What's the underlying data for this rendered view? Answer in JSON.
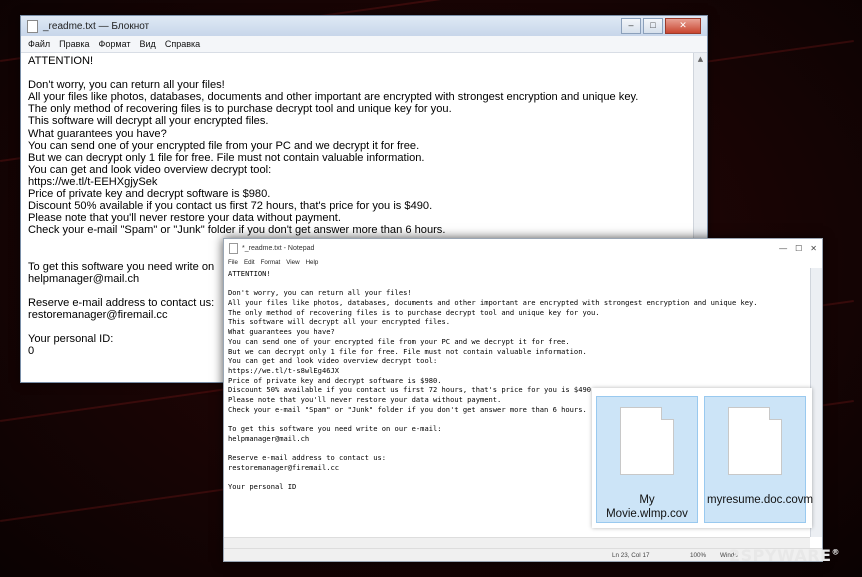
{
  "window1": {
    "title": "_readme.txt — Блокнот",
    "menu": [
      "Файл",
      "Правка",
      "Формат",
      "Вид",
      "Справка"
    ],
    "lines": [
      "ATTENTION!",
      "",
      "Don't worry, you can return all your files!",
      "All your files like photos, databases, documents and other important are encrypted with strongest encryption and unique key.",
      "The only method of recovering files is to purchase decrypt tool and unique key for you.",
      "This software will decrypt all your encrypted files.",
      "What guarantees you have?",
      "You can send one of your encrypted file from your PC and we decrypt it for free.",
      "But we can decrypt only 1 file for free. File must not contain valuable information.",
      "You can get and look video overview decrypt tool:",
      "https://we.tl/t-EEHXgjySek",
      "Price of private key and decrypt software is $980.",
      "Discount 50% available if you contact us first 72 hours, that's price for you is $490.",
      "Please note that you'll never restore your data without payment.",
      "Check your e-mail \"Spam\" or \"Junk\" folder if you don't get answer more than 6 hours.",
      "",
      "",
      "To get this software you need write on",
      "helpmanager@mail.ch",
      "",
      "Reserve e-mail address to contact us:",
      "restoremanager@firemail.cc",
      "",
      "Your personal ID:",
      "0"
    ]
  },
  "window2": {
    "title": "*_readme.txt - Notepad",
    "menu": [
      "File",
      "Edit",
      "Format",
      "View",
      "Help"
    ],
    "lines": [
      "ATTENTION!",
      "",
      "Don't worry, you can return all your files!",
      "All your files like photos, databases, documents and other important are encrypted with strongest encryption and unique key.",
      "The only method of recovering files is to purchase decrypt tool and unique key for you.",
      "This software will decrypt all your encrypted files.",
      "What guarantees you have?",
      "You can send one of your encrypted file from your PC and we decrypt it for free.",
      "But we can decrypt only 1 file for free. File must not contain valuable information.",
      "You can get and look video overview decrypt tool:",
      "https://we.tl/t-s8wlEg46JX",
      "Price of private key and decrypt software is $980.",
      "Discount 50% available if you contact us first 72 hours, that's price for you is $490.",
      "Please note that you'll never restore your data without payment.",
      "Check your e-mail \"Spam\" or \"Junk\" folder if you don't get answer more than 6 hours.",
      "",
      "To get this software you need write on our e-mail:",
      "helpmanager@mail.ch",
      "",
      "Reserve e-mail address to contact us:",
      "restoremanager@firemail.cc",
      "",
      "Your personal ID"
    ],
    "status": {
      "position": "Ln 23, Col 17",
      "zoom": "100%",
      "eol": "Windo"
    }
  },
  "files": [
    {
      "name": "My Movie.wlmp.cov"
    },
    {
      "name": "myresume.doc.covm"
    }
  ],
  "watermark": {
    "text": "2SPYWARE",
    "mark": "®"
  },
  "colors": {
    "selection": "#cce4f7",
    "background": "#1c0505"
  }
}
